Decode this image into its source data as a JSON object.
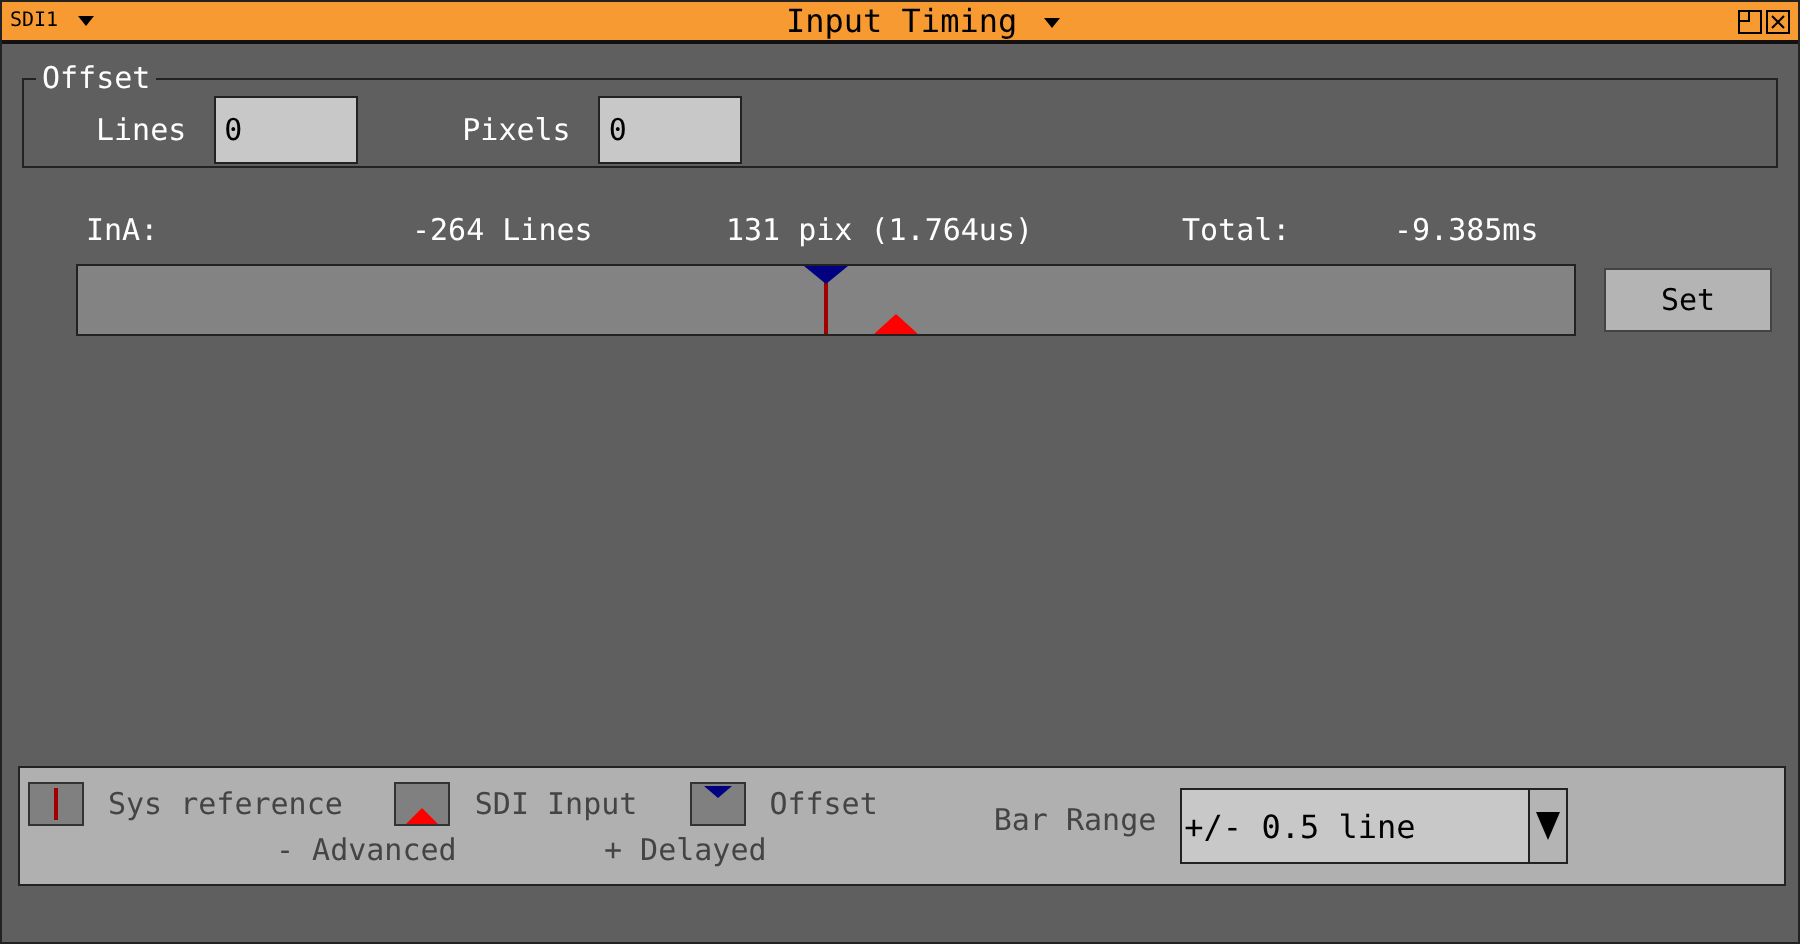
{
  "window": {
    "source": "SDI1",
    "title": "Input Timing"
  },
  "offset": {
    "title": "Offset",
    "fields": [
      {
        "label": "Lines",
        "value": "0"
      },
      {
        "label": "Pixels",
        "value": "0"
      }
    ]
  },
  "readout": {
    "input": "InA:",
    "lines": "-264 Lines",
    "pixels": "131 pix (1.764us)",
    "total_label": "Total:",
    "total": "-9.385ms"
  },
  "bar": {
    "markers": [
      {
        "kind": "reference",
        "level": 0.5
      },
      {
        "kind": "offset",
        "level": 0.5
      },
      {
        "kind": "input",
        "level": 0.547
      }
    ]
  },
  "set_button": "Set",
  "legend": {
    "items": [
      {
        "kind": "reference",
        "label": "Sys reference"
      },
      {
        "kind": "input",
        "label": "SDI Input",
        "note": "- Advanced"
      },
      {
        "kind": "offset",
        "label": "Offset",
        "note": "+ Delayed"
      }
    ],
    "range_label": "Bar Range",
    "range_value": "+/- 0.5 line"
  }
}
